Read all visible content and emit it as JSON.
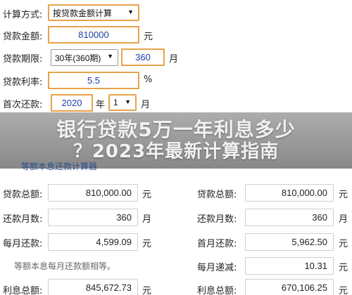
{
  "form": {
    "calc_method": {
      "label": "计算方式:",
      "value": "按贷款金额计算"
    },
    "loan_amount": {
      "label": "贷款金额:",
      "value": "810000",
      "unit": "元"
    },
    "loan_term": {
      "label": "贷款期限:",
      "select_value": "30年(360期)",
      "months_value": "360",
      "unit": "月"
    },
    "interest_rate": {
      "label": "贷款利率:",
      "value": "5.5",
      "unit": "%"
    },
    "first_payment": {
      "label": "首次还款:",
      "year_value": "2020",
      "year_unit": "年",
      "month_value": "1",
      "month_unit": "月"
    }
  },
  "overlay": {
    "title_line1": "银行贷款5万一年利息多少",
    "title_line2": "？2023年最新计算指南",
    "left_heading": "等额本息还款计算器"
  },
  "results_left": {
    "loan_total": {
      "label": "贷款总额:",
      "value": "810,000.00",
      "unit": "元"
    },
    "months": {
      "label": "还款月数:",
      "value": "360",
      "unit": "月"
    },
    "monthly": {
      "label": "每月还款:",
      "value": "4,599.09",
      "unit": "元"
    },
    "note": "等额本息每月还款额相等。",
    "interest_total": {
      "label": "利息总额:",
      "value": "845,672.73",
      "unit": "元"
    }
  },
  "results_right": {
    "loan_total": {
      "label": "贷款总额:",
      "value": "810,000.00",
      "unit": "元"
    },
    "months": {
      "label": "还款月数:",
      "value": "360",
      "unit": "月"
    },
    "first_month": {
      "label": "首月还款:",
      "value": "5,962.50",
      "unit": "元"
    },
    "monthly_decrease": {
      "label": "每月递减:",
      "value": "10.31",
      "unit": "元"
    },
    "interest_total": {
      "label": "利息总额:",
      "value": "670,106.25",
      "unit": "元"
    }
  },
  "icons": {
    "dropdown": "chevron-down-icon"
  }
}
